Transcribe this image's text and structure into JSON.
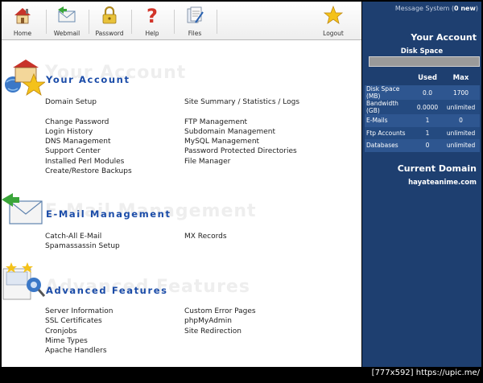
{
  "toolbar": {
    "home": "Home",
    "webmail": "Webmail",
    "password": "Password",
    "help": "Help",
    "files": "Files",
    "logout": "Logout"
  },
  "sections": {
    "account": {
      "title": "Your Account",
      "ghost": "Your Account",
      "col1": [
        "Domain Setup",
        "",
        "Change Password",
        "Login History",
        "DNS Management",
        "Support Center",
        "Installed Perl Modules",
        "Create/Restore Backups"
      ],
      "col2": [
        "Site Summary / Statistics / Logs",
        "",
        "FTP Management",
        "Subdomain Management",
        "MySQL Management",
        "Password Protected Directories",
        "File Manager"
      ]
    },
    "email": {
      "title": "E-Mail Management",
      "ghost": "E-Mail Management",
      "col1": [
        "Catch-All E-Mail",
        "Spamassassin Setup"
      ],
      "col2": [
        "MX Records"
      ]
    },
    "advanced": {
      "title": "Advanced Features",
      "ghost": "Advanced Features",
      "col1": [
        "Server Information",
        "SSL Certificates",
        "Cronjobs",
        "Mime Types",
        "Apache Handlers"
      ],
      "col2": [
        "Custom Error Pages",
        "phpMyAdmin",
        "Site Redirection"
      ]
    }
  },
  "sidebar": {
    "message_prefix": "Message System (",
    "message_count": "0 new",
    "message_suffix": ")",
    "account_title": "Your Account",
    "disk_label": "Disk Space",
    "disk_usage_fraction": 0.0,
    "stats_headers": [
      "",
      "Used",
      "Max"
    ],
    "stats_rows": [
      [
        "Disk Space (MB)",
        "0.0",
        "1700"
      ],
      [
        "Bandwidth (GB)",
        "0.0000",
        "unlimited"
      ],
      [
        "E-Mails",
        "1",
        "0"
      ],
      [
        "Ftp Accounts",
        "1",
        "unlimited"
      ],
      [
        "Databases",
        "0",
        "unlimited"
      ]
    ],
    "domain_title": "Current Domain",
    "domain_value": "hayateanime.com"
  },
  "footer": "[777x592] https://upic.me/",
  "colors": {
    "sidebar_bg": "#1e3f70",
    "section_title": "#1b4ca8",
    "table_row_a": "#2e5690",
    "table_row_b": "#244a80"
  }
}
